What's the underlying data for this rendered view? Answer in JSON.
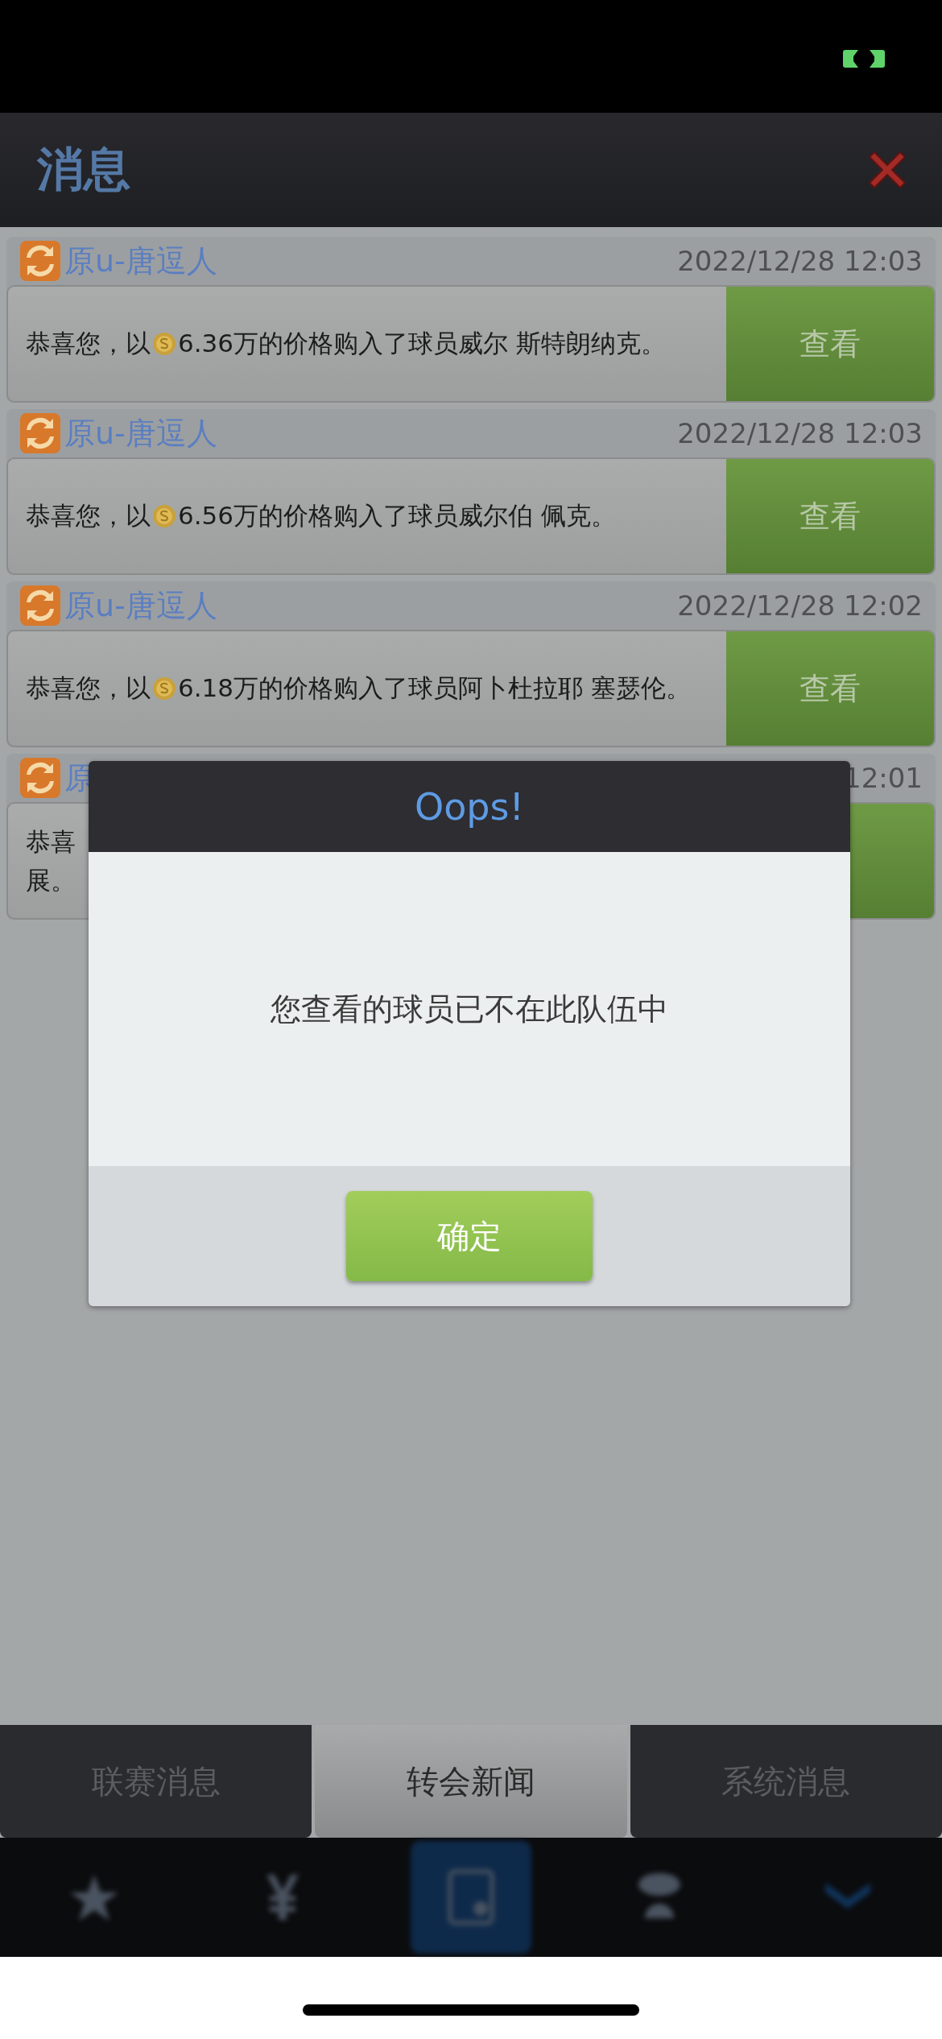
{
  "header": {
    "title": "消息"
  },
  "messages": [
    {
      "sender": "原u-唐逗人",
      "time": "2022/12/28 12:03",
      "text_before": "恭喜您，以",
      "text_after": "6.36万的价格购入了球员威尔  斯特朗纳克。",
      "button": "查看"
    },
    {
      "sender": "原u-唐逗人",
      "time": "2022/12/28 12:03",
      "text_before": "恭喜您，以",
      "text_after": "6.56万的价格购入了球员威尔伯 佩克。",
      "button": "查看"
    },
    {
      "sender": "原u-唐逗人",
      "time": "2022/12/28 12:02",
      "text_before": "恭喜您，以",
      "text_after": "6.18万的价格购入了球员阿卜杜拉耶 塞瑟伦。",
      "button": "查看"
    },
    {
      "sender": "原",
      "time": "12:01",
      "text_lines": [
        "恭喜",
        "展。"
      ]
    }
  ],
  "dialog": {
    "title": "Oops!",
    "message": "您查看的球员已不在此队伍中",
    "button": "确定"
  },
  "tabs": [
    {
      "label": "联赛消息",
      "selected": false
    },
    {
      "label": "转会新闻",
      "selected": true
    },
    {
      "label": "系统消息",
      "selected": false
    }
  ],
  "nav": [
    {
      "kind": "star",
      "selected": false
    },
    {
      "kind": "yen",
      "selected": false
    },
    {
      "kind": "card",
      "selected": true
    },
    {
      "kind": "dome",
      "selected": false
    },
    {
      "kind": "chevron",
      "selected": false
    }
  ]
}
